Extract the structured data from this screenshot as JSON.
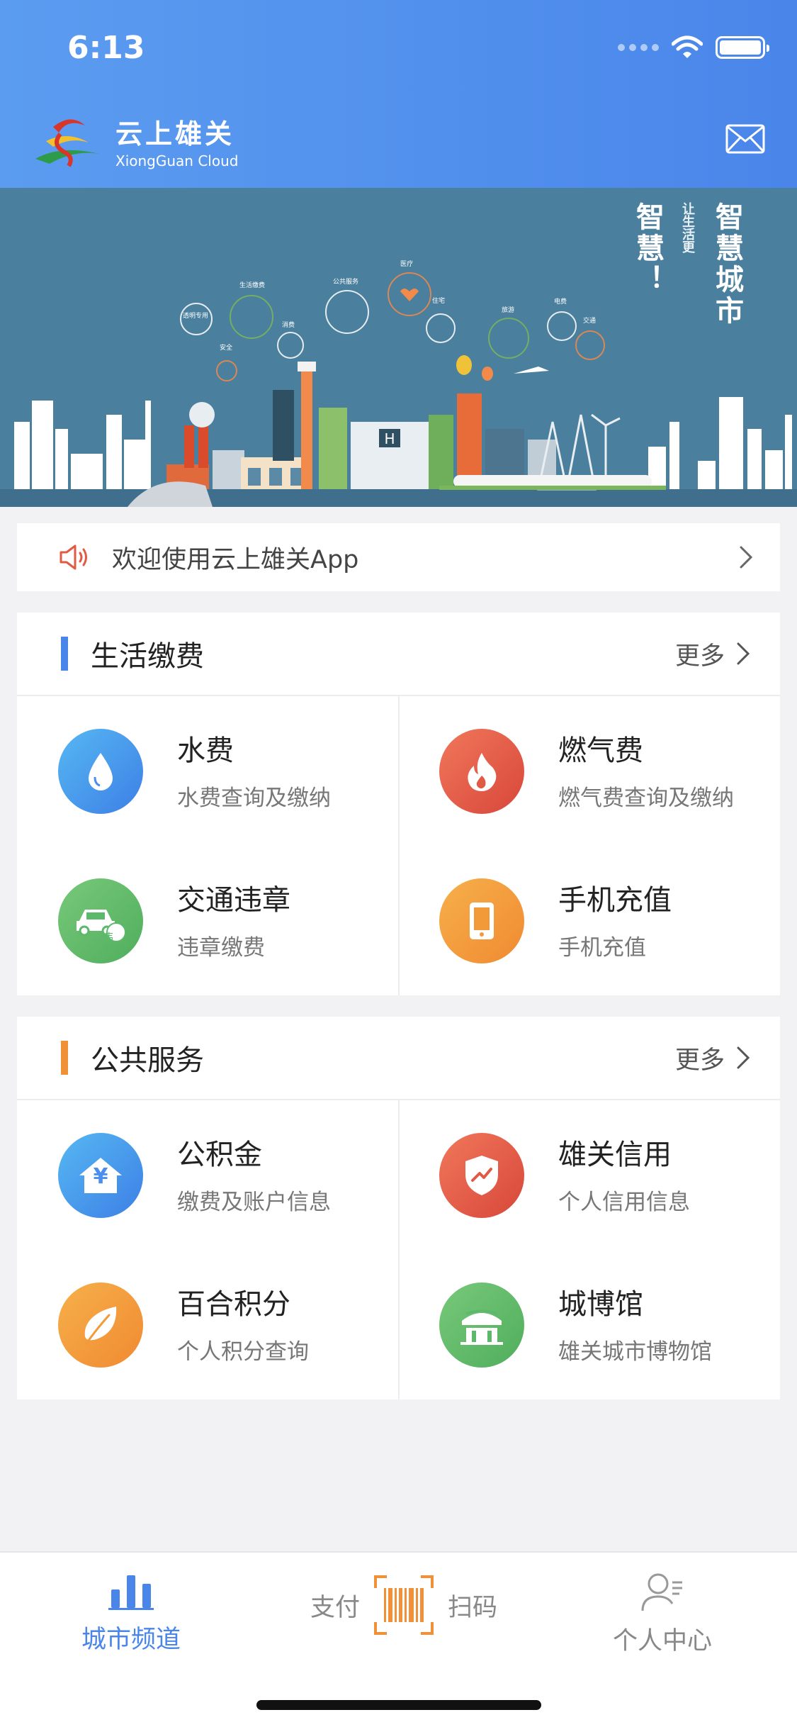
{
  "status_bar": {
    "time": "6:13"
  },
  "app": {
    "name_cn": "云上雄关",
    "name_en": "XiongGuan Cloud"
  },
  "banner": {
    "slogan_main": "智慧城市",
    "slogan_small": "让生活更",
    "slogan_side": "智慧！",
    "labels": [
      "透明专用",
      "生活缴费",
      "公共服务",
      "医疗",
      "住宅",
      "旅游",
      "电费",
      "交通",
      "安全",
      "消费"
    ]
  },
  "notice": {
    "text": "欢迎使用云上雄关App"
  },
  "life_payment": {
    "title": "生活缴费",
    "more": "更多",
    "accent": "#4a86ea",
    "items": [
      {
        "title": "水费",
        "subtitle": "水费查询及缴纳",
        "icon": "water-drop-icon",
        "color": "#4a8ef0"
      },
      {
        "title": "燃气费",
        "subtitle": "燃气费查询及缴纳",
        "icon": "flame-icon",
        "color": "#e05a44"
      },
      {
        "title": "交通违章",
        "subtitle": "违章缴费",
        "icon": "car-icon",
        "color": "#5cb86a",
        "badge": "违"
      },
      {
        "title": "手机充值",
        "subtitle": "手机充值",
        "icon": "phone-icon",
        "color": "#f29a3a"
      }
    ]
  },
  "public_service": {
    "title": "公共服务",
    "more": "更多",
    "accent": "#f0913a",
    "items": [
      {
        "title": "公积金",
        "subtitle": "缴费及账户信息",
        "icon": "house-yuan-icon",
        "color": "#4a8ef0",
        "glyph": "¥"
      },
      {
        "title": "雄关信用",
        "subtitle": "个人信用信息",
        "icon": "shield-icon",
        "color": "#e05a44"
      },
      {
        "title": "百合积分",
        "subtitle": "个人积分查询",
        "icon": "leaf-icon",
        "color": "#f29a3a"
      },
      {
        "title": "城博馆",
        "subtitle": "雄关城市博物馆",
        "icon": "museum-icon",
        "color": "#5cb86a"
      }
    ]
  },
  "tabbar": {
    "city": "城市频道",
    "pay": "支付",
    "scan": "扫码",
    "personal": "个人中心",
    "active_color": "#4a86ea",
    "scan_color": "#f0913a"
  }
}
